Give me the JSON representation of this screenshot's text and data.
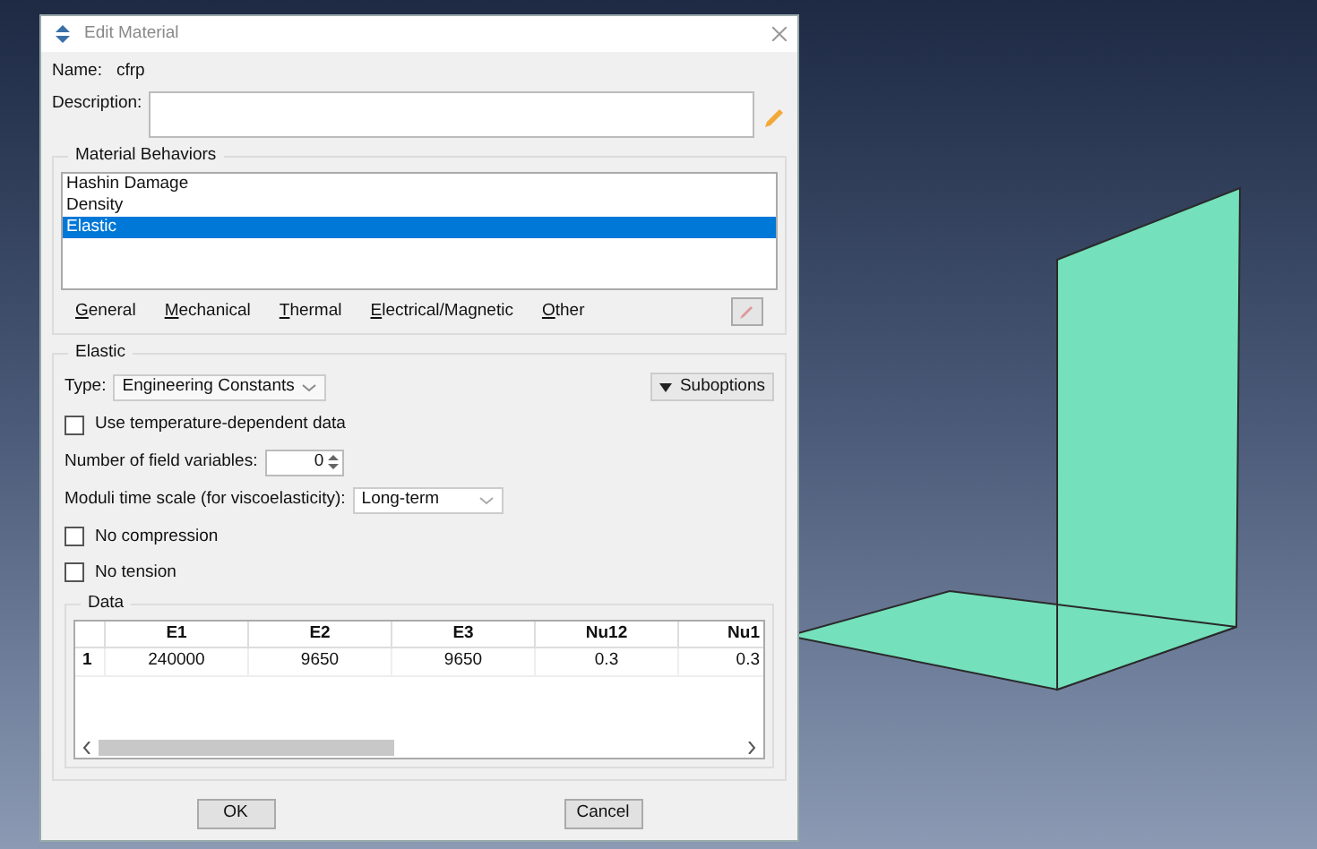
{
  "window": {
    "title": "Edit Material"
  },
  "name": {
    "label": "Name:",
    "value": "cfrp"
  },
  "description": {
    "label": "Description:"
  },
  "behaviors": {
    "title": "Material Behaviors",
    "items": [
      {
        "label": "Hashin Damage",
        "selected": false
      },
      {
        "label": "Density",
        "selected": false
      },
      {
        "label": "Elastic",
        "selected": true
      }
    ],
    "menus": [
      "General",
      "Mechanical",
      "Thermal",
      "Electrical/Magnetic",
      "Other"
    ]
  },
  "elastic": {
    "title": "Elastic",
    "type_label": "Type:",
    "type_value": "Engineering Constants",
    "suboptions": "Suboptions",
    "temperature": {
      "label": "Use temperature-dependent data",
      "checked": false
    },
    "field_variables": {
      "label": "Number of field variables:",
      "value": "0"
    },
    "time_scale": {
      "label": "Moduli time scale (for viscoelasticity):",
      "value": "Long-term"
    },
    "options": [
      {
        "label": "No compression",
        "checked": false
      },
      {
        "label": "No tension",
        "checked": false
      }
    ]
  },
  "data": {
    "title": "Data",
    "columns": [
      "E1",
      "E2",
      "E3",
      "Nu12",
      "Nu1"
    ],
    "rows": [
      {
        "index": "1",
        "cells": [
          "240000",
          "9650",
          "9650",
          "0.3",
          "0.3"
        ]
      }
    ]
  },
  "buttons": [
    "OK",
    "Cancel"
  ]
}
